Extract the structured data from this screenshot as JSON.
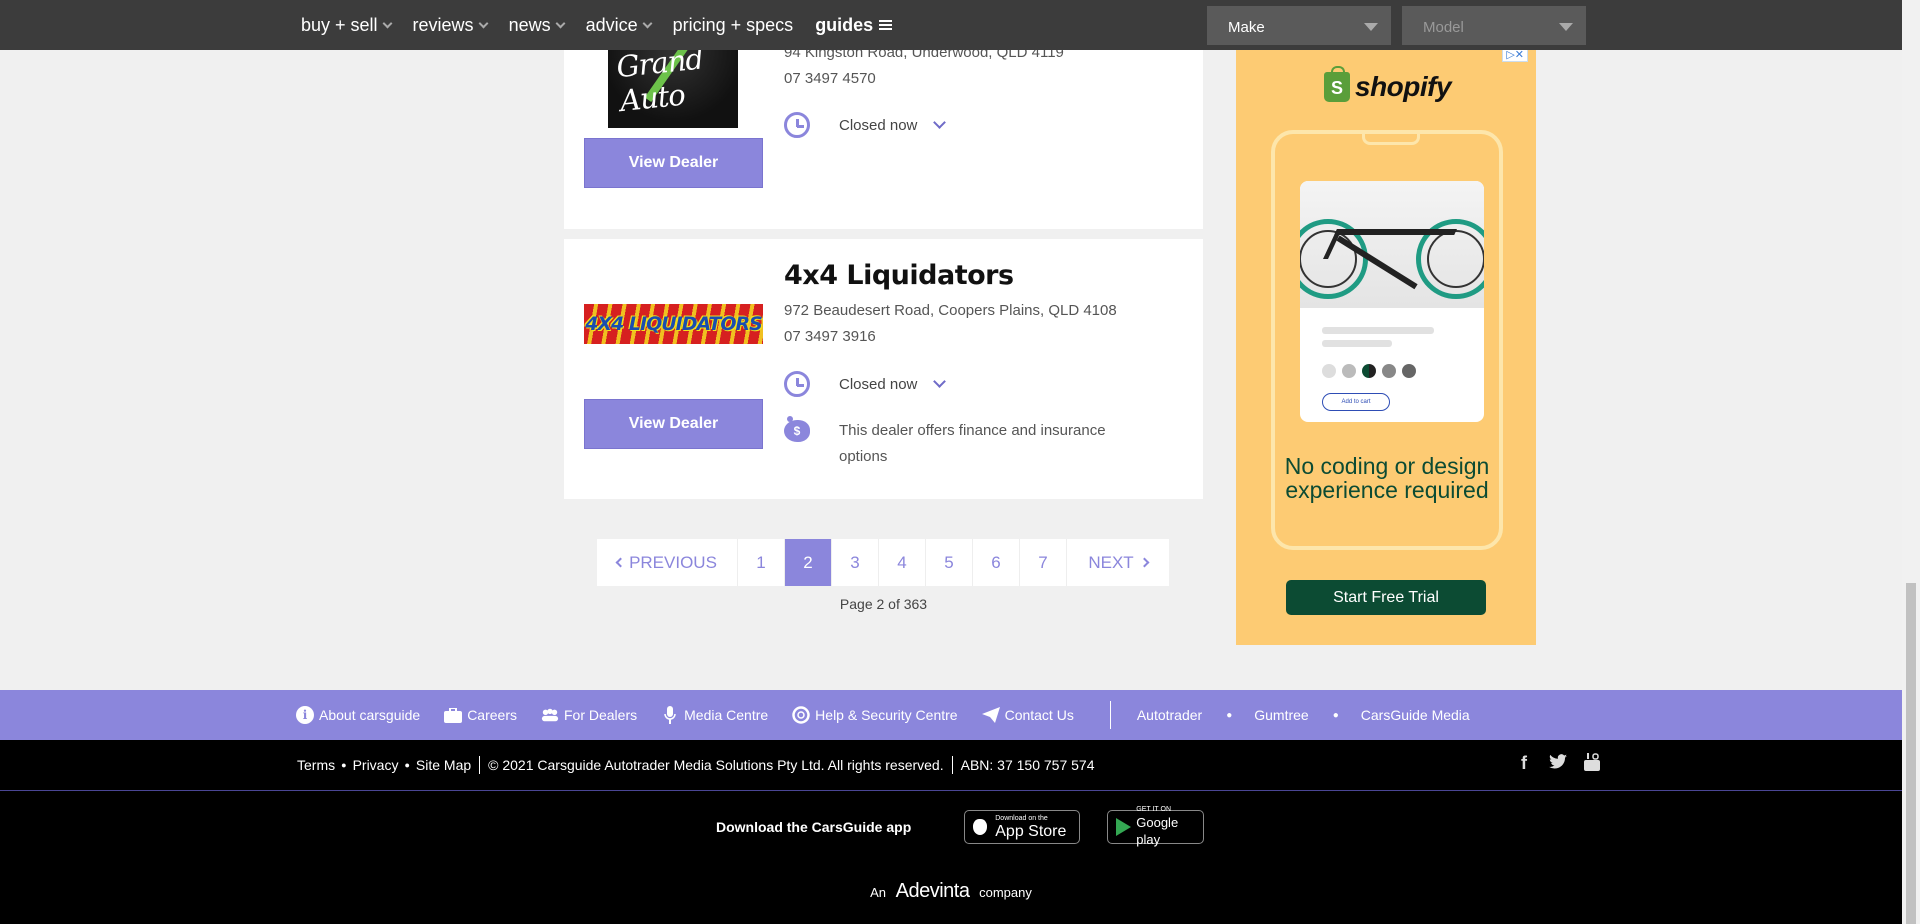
{
  "nav": {
    "items": [
      {
        "label": "buy + sell",
        "chevron": true
      },
      {
        "label": "reviews",
        "chevron": true
      },
      {
        "label": "news",
        "chevron": true
      },
      {
        "label": "advice",
        "chevron": true
      },
      {
        "label": "pricing + specs",
        "chevron": false
      }
    ],
    "guides_label": "guides",
    "make_placeholder": "Make",
    "model_placeholder": "Model"
  },
  "dealers": [
    {
      "logo_text": "Grand Auto",
      "address": "94 Kingston Road, Underwood, QLD 4119",
      "phone": "07 3497 4570",
      "hours_status": "Closed now",
      "view_label": "View Dealer"
    },
    {
      "name": "4x4 Liquidators",
      "logo_text": "4X4 LIQUIDATORS",
      "address": "972 Beaudesert Road, Coopers Plains, QLD 4108",
      "phone": "07 3497 3916",
      "hours_status": "Closed now",
      "finance_text": "This dealer offers finance and insurance options",
      "view_label": "View Dealer"
    }
  ],
  "pagination": {
    "prev_label": "PREVIOUS",
    "next_label": "NEXT",
    "pages": [
      "1",
      "2",
      "3",
      "4",
      "5",
      "6",
      "7"
    ],
    "current": "2",
    "info": "Page 2 of 363"
  },
  "ad": {
    "brand": "shopify",
    "add_to_cart": "Add to cart",
    "headline": "No coding or design experience required",
    "cta": "Start Free Trial",
    "close": "▷✕"
  },
  "footer": {
    "links": [
      {
        "label": "About carsguide",
        "icon": "info-icon"
      },
      {
        "label": "Careers",
        "icon": "briefcase-icon"
      },
      {
        "label": "For Dealers",
        "icon": "group-icon"
      },
      {
        "label": "Media Centre",
        "icon": "microphone-icon"
      },
      {
        "label": "Help & Security Centre",
        "icon": "lifebuoy-icon"
      },
      {
        "label": "Contact Us",
        "icon": "paper-plane-icon"
      }
    ],
    "partners": [
      "Autotrader",
      "Gumtree",
      "CarsGuide Media"
    ],
    "legal_links": [
      "Terms",
      "Privacy",
      "Site Map"
    ],
    "copyright": "© 2021 Carsguide Autotrader Media Solutions Pty Ltd. All rights reserved.",
    "abn": "ABN: 37 150 757 574",
    "app_label": "Download the CarsGuide app",
    "appstore_small": "Download on the",
    "appstore_big": "App Store",
    "google_small": "GET IT ON",
    "google_big": "Google play",
    "adevinta_prefix": "An",
    "adevinta_brand": "Adevinta",
    "adevinta_suffix": "company"
  },
  "colors": {
    "accent": "#8b86dc",
    "nav_bg": "#3c3c3c",
    "ad_bg": "#fdcb73",
    "ad_dark": "#0c4b33"
  }
}
